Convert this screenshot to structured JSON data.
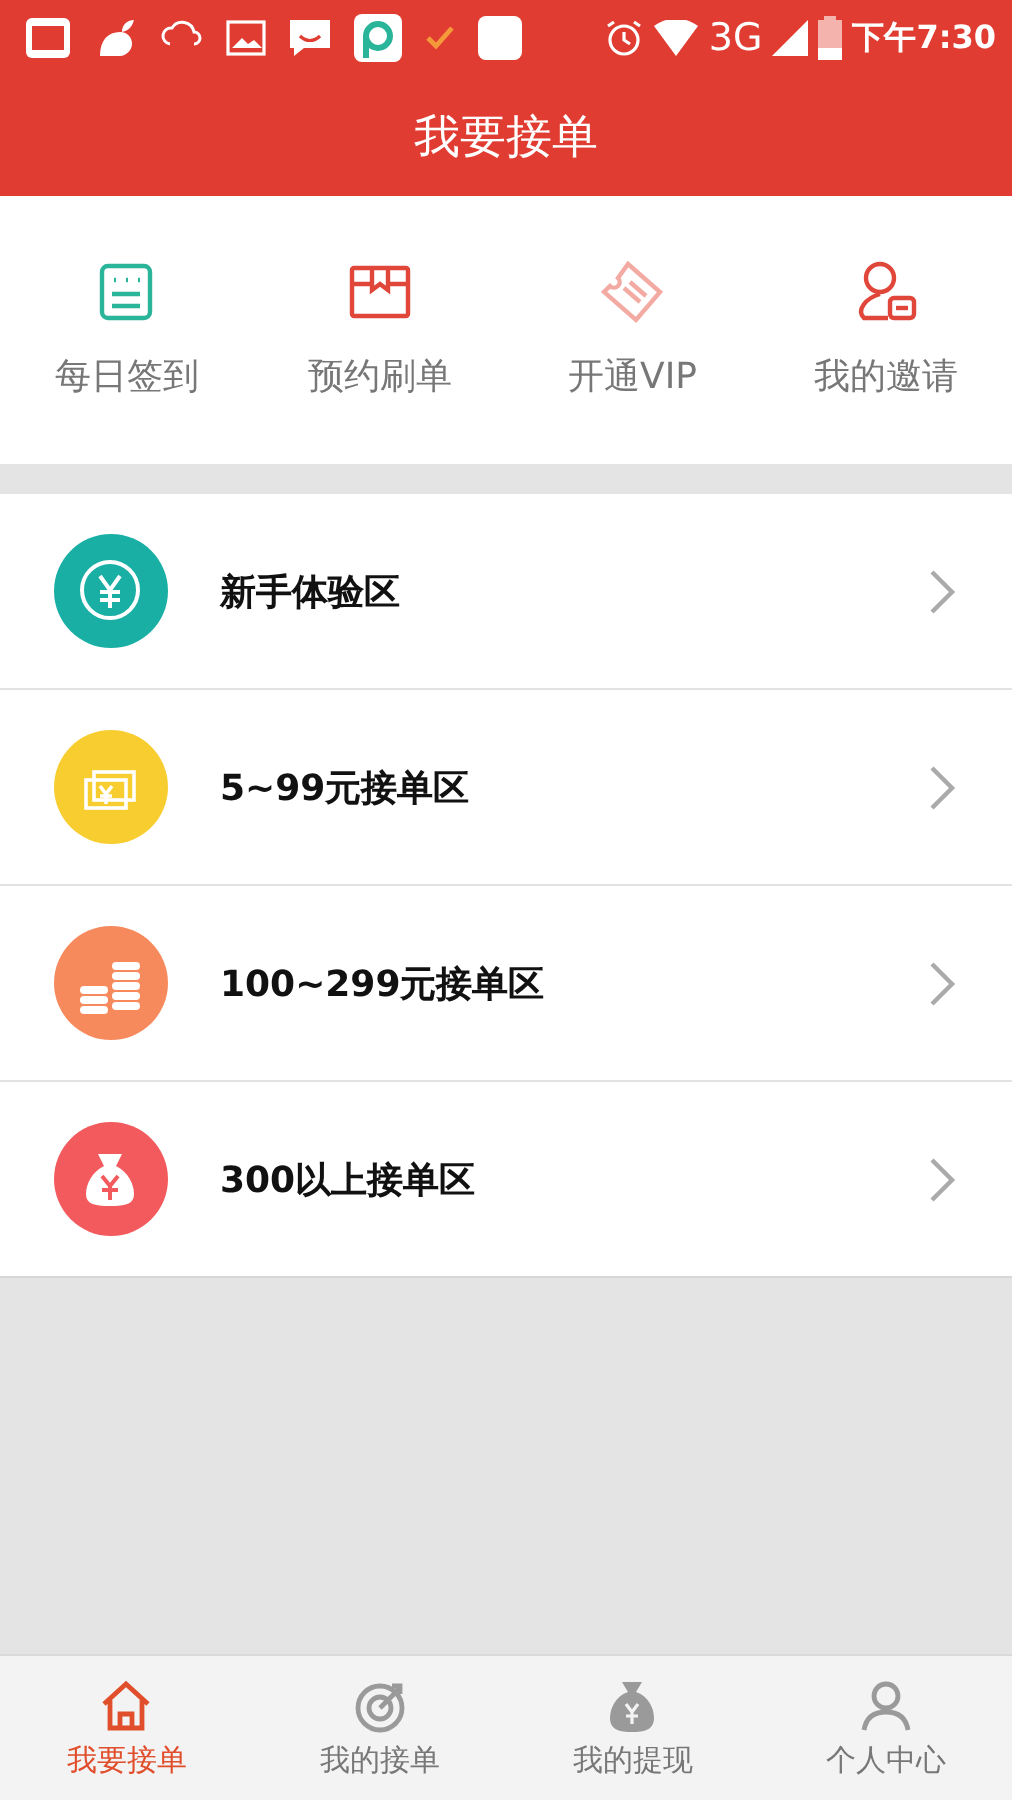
{
  "status_bar": {
    "network": "3G",
    "time": "下午7:30"
  },
  "header": {
    "title": "我要接单"
  },
  "quick_actions": [
    {
      "label": "每日签到"
    },
    {
      "label": "预约刷单"
    },
    {
      "label": "开通VIP"
    },
    {
      "label": "我的邀请"
    }
  ],
  "zones": [
    {
      "label": "新手体验区",
      "color": "#1aafa4"
    },
    {
      "label": "5~99元接单区",
      "color": "#f8cd30"
    },
    {
      "label": "100~299元接单区",
      "color": "#f78a5d"
    },
    {
      "label": "300以上接单区",
      "color": "#f25a5d"
    }
  ],
  "tab_bar": [
    {
      "label": "我要接单",
      "selected": true
    },
    {
      "label": "我的接单",
      "selected": false
    },
    {
      "label": "我的提现",
      "selected": false
    },
    {
      "label": "个人中心",
      "selected": false
    }
  ]
}
